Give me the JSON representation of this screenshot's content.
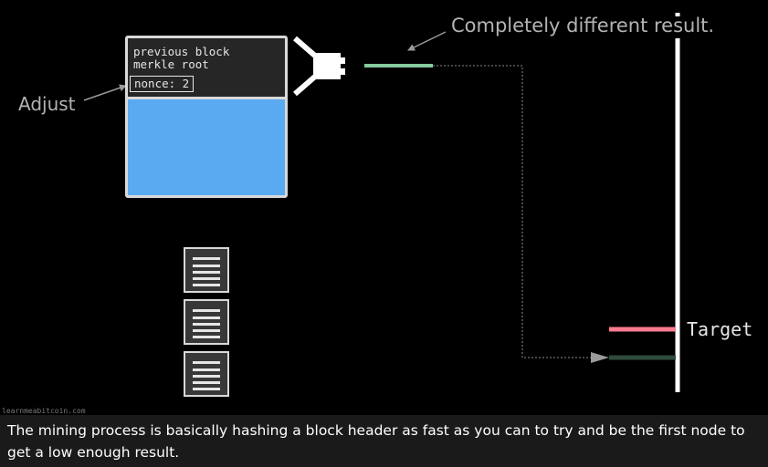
{
  "block": {
    "line1": "previous block",
    "line2": "merkle root",
    "nonce": "nonce: 2"
  },
  "annotations": {
    "adjust": "Adjust",
    "result": "Completely different result.",
    "target": "Target"
  },
  "colors": {
    "background": "#000000",
    "block_body": "#59aaf0",
    "result_hash": "#86c99a",
    "target_line": "#ff7b8e",
    "new_hash": "#2f4a3b"
  },
  "icons": [
    "hash-function-icon",
    "transaction-icon"
  ],
  "watermark": "learnmeabitcoin.com",
  "caption": "The mining process is basically hashing a block header as fast as you can to try and be the first node to get a low enough result."
}
